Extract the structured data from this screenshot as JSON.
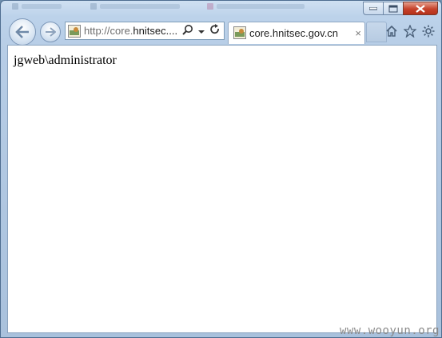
{
  "browser": {
    "address_bar": {
      "url_prefix": "http://core.",
      "url_host": "hnitsec....",
      "icons": [
        "search-icon",
        "dropdown-arrow-icon",
        "refresh-icon"
      ]
    },
    "tab": {
      "title": "core.hnitsec.gov.cn",
      "close_glyph": "×"
    },
    "toolbar_icons": [
      "home-icon",
      "favorites-star-icon",
      "tools-gear-icon"
    ],
    "window_buttons": [
      "minimize",
      "maximize",
      "close"
    ]
  },
  "page": {
    "text": "jgweb\\administrator"
  },
  "watermark": {
    "text": "www.wooyun.org"
  },
  "colors": {
    "accent": "#3a6ea5",
    "close": "#c6422b"
  }
}
